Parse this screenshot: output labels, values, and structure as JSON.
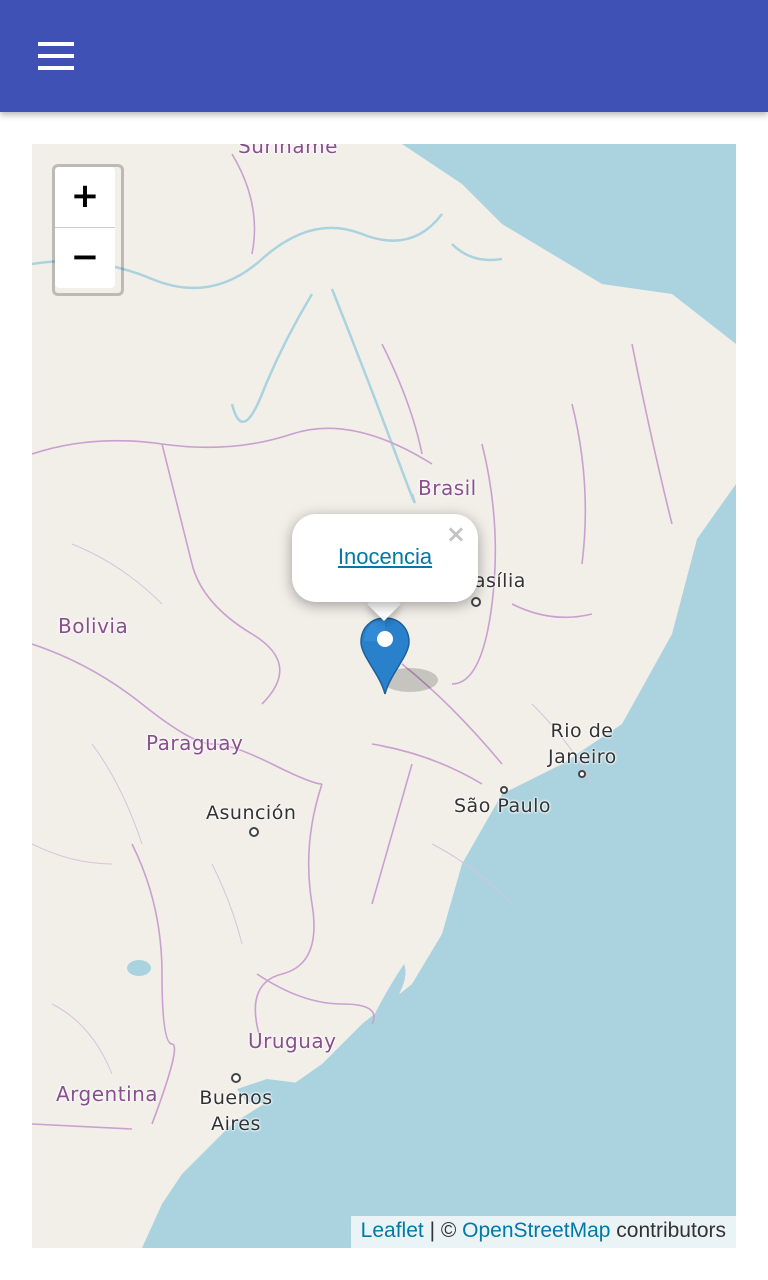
{
  "appbar": {
    "color": "#3f51b5",
    "menu_icon": "hamburger-menu-icon"
  },
  "map": {
    "zoom_in_label": "+",
    "zoom_out_label": "−",
    "labels": {
      "suriname": "Suriname",
      "brasil": "Brasil",
      "brasilia": "Brasília",
      "bolivia": "Bolivia",
      "paraguay": "Paraguay",
      "asuncion": "Asunción",
      "rio_line1": "Rio de",
      "rio_line2": "Janeiro",
      "sao_paulo": "São Paulo",
      "uruguay": "Uruguay",
      "argentina": "Argentina",
      "buenos_aires_line1": "Buenos",
      "buenos_aires_line2": "Aires"
    },
    "marker_icon": "map-pin-icon",
    "popup": {
      "link_text": "Inocencia",
      "close_label": "×"
    },
    "attribution": {
      "leaflet": "Leaflet",
      "separator": " | © ",
      "osm": "OpenStreetMap",
      "suffix": " contributors"
    },
    "colors": {
      "land": "#f2efe9",
      "water": "#aad3df",
      "border": "#c9a0cf"
    }
  }
}
